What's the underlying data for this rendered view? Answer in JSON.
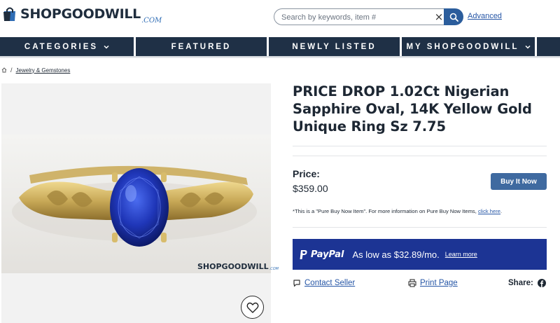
{
  "brand": {
    "name": "SHOPGOODWILL",
    "suffix": ".COM",
    "accent": "#2f6db5",
    "nav_bg": "#1f3046"
  },
  "search": {
    "placeholder": "Search by keywords, item #",
    "value": "",
    "advanced_label": "Advanced"
  },
  "nav": {
    "categories": "CATEGORIES",
    "featured": "FEATURED",
    "newly_listed": "NEWLY LISTED",
    "my_shopgoodwill": "MY SHOPGOODWILL"
  },
  "breadcrumb": {
    "home_icon": "home-icon",
    "separator": "/",
    "category": "Jewelry & Gemstones"
  },
  "product": {
    "title": "PRICE DROP 1.02Ct Nigerian Sapphire Oval, 14K Yellow Gold Unique Ring Sz 7.75",
    "price_label": "Price:",
    "price": "$359.00",
    "buy_button": "Buy It Now",
    "buy_button_color": "#3f6aa0",
    "note_text": "*This is a \"Pure Buy Now Item\". For more information on Pure Buy Now Items, ",
    "note_link": "click here",
    "note_end": "."
  },
  "paypal": {
    "logo_text": "PayPal",
    "offer": "As low as $32.89/mo.",
    "learn_more": "Learn more",
    "bg": "#1c3494"
  },
  "actions": {
    "contact_seller": "Contact Seller",
    "print_page": "Print Page",
    "share_label": "Share:"
  },
  "image": {
    "watermark": "SHOPGOODWILL",
    "watermark_suffix": ".COM"
  }
}
